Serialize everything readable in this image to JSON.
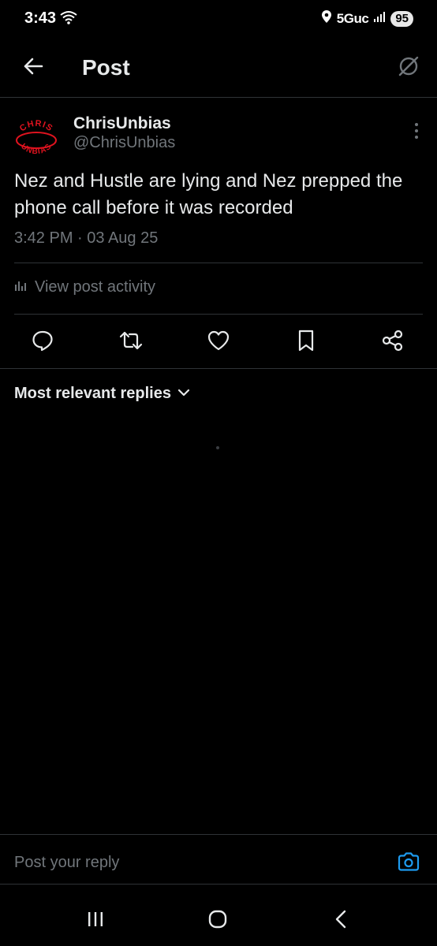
{
  "status_bar": {
    "time": "3:43",
    "network": "5Guc",
    "battery": "95",
    "icons": [
      "wifi-icon",
      "location-icon",
      "signal-icon"
    ]
  },
  "header": {
    "title": "Post",
    "icons": [
      "back-arrow-icon",
      "grok-icon"
    ]
  },
  "post": {
    "author_name": "ChrisUnbias",
    "author_handle": "@ChrisUnbias",
    "avatar_logo_text": "CHRIS UNBIAS",
    "text": "Nez and Hustle are lying and Nez prepped the phone call before it was recorded",
    "timestamp": "3:42 PM · 03 Aug 25",
    "activity_label": "View post activity",
    "actions": [
      "reply-icon",
      "repost-icon",
      "like-icon",
      "bookmark-icon",
      "share-icon"
    ]
  },
  "replies": {
    "sort_label": "Most relevant replies"
  },
  "reply_composer": {
    "placeholder": "Post your reply"
  },
  "colors": {
    "background": "#000000",
    "text_primary": "#e7e9ea",
    "text_secondary": "#71767b",
    "divider": "#2f3336",
    "accent": "#1d9bf0",
    "logo_red": "#e0131f"
  }
}
